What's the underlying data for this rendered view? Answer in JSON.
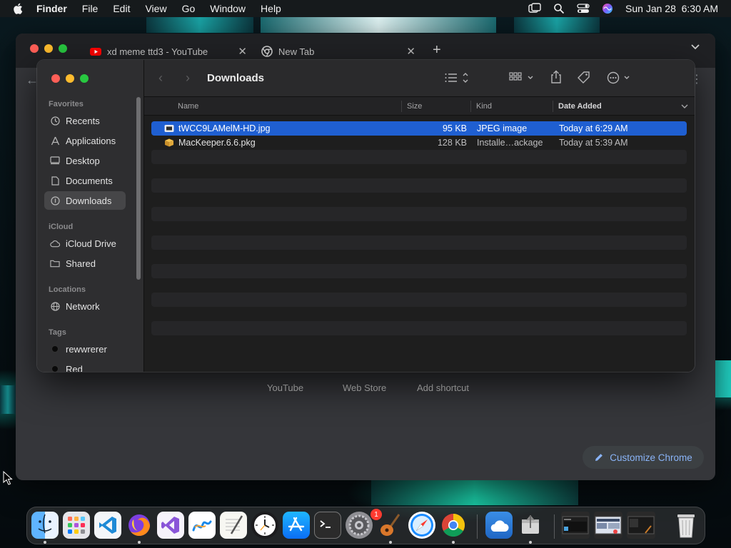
{
  "menubar": {
    "app": "Finder",
    "items": [
      "File",
      "Edit",
      "View",
      "Go",
      "Window",
      "Help"
    ],
    "datetime": "Sun Jan 28  6:30 AM"
  },
  "chrome": {
    "tabs": [
      {
        "title": "xd meme ttd3 - YouTube",
        "icon": "youtube-icon"
      },
      {
        "title": "New Tab",
        "icon": "chrome-icon"
      }
    ],
    "shortcuts": [
      "YouTube",
      "Web Store",
      "Add shortcut"
    ],
    "customize_label": "Customize Chrome"
  },
  "finder": {
    "title": "Downloads",
    "sidebar": {
      "favorites_label": "Favorites",
      "favorites": [
        {
          "label": "Recents",
          "icon": "clock-icon"
        },
        {
          "label": "Applications",
          "icon": "applications-icon"
        },
        {
          "label": "Desktop",
          "icon": "desktop-icon"
        },
        {
          "label": "Documents",
          "icon": "document-icon"
        },
        {
          "label": "Downloads",
          "icon": "download-icon",
          "selected": true
        }
      ],
      "icloud_label": "iCloud",
      "icloud": [
        {
          "label": "iCloud Drive",
          "icon": "cloud-icon"
        },
        {
          "label": "Shared",
          "icon": "shared-folder-icon"
        }
      ],
      "locations_label": "Locations",
      "locations": [
        {
          "label": "Network",
          "icon": "globe-icon"
        }
      ],
      "tags_label": "Tags",
      "tags": [
        {
          "label": "rewwrerer",
          "color": "#000000"
        },
        {
          "label": "Red",
          "color": "#000000"
        }
      ]
    },
    "columns": {
      "name": "Name",
      "size": "Size",
      "kind": "Kind",
      "date": "Date Added"
    },
    "files": [
      {
        "name": "tWCC9LAMelM-HD.jpg",
        "size": "95 KB",
        "kind": "JPEG image",
        "date": "Today at 6:29 AM",
        "selected": true,
        "icon": "image-file-icon"
      },
      {
        "name": "MacKeeper.6.6.pkg",
        "size": "128 KB",
        "kind": "Installe…ackage",
        "date": "Today at 5:39 AM",
        "selected": false,
        "icon": "package-icon"
      }
    ]
  },
  "dock": {
    "apps": [
      "Finder",
      "Launchpad",
      "Visual Studio Code",
      "Firefox",
      "Visual Studio",
      "Freeform",
      "TextEdit",
      "Clock",
      "App Store",
      "Terminal",
      "System Settings",
      "GarageBand",
      "Safari",
      "Chrome",
      "Weather",
      "Installer",
      "Trash"
    ],
    "settings_badge": "1"
  },
  "colors": {
    "selection": "#1f5fd1",
    "accent_link": "#8ab4f8"
  }
}
